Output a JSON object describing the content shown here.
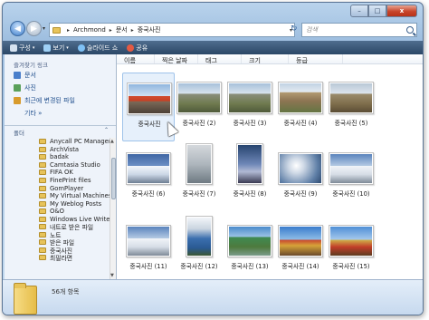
{
  "caption": {
    "minimize": "–",
    "maximize": "□",
    "close": "x"
  },
  "nav": {
    "back": "◀",
    "forward": "▶",
    "dropdown": "▾"
  },
  "address": {
    "crumbs": [
      "Archmond",
      "문서",
      "중국사진"
    ],
    "separator": "▸",
    "dropdown": "▾",
    "refresh": "↻"
  },
  "search": {
    "placeholder": "검색"
  },
  "commandbar": {
    "items": [
      {
        "label": "구성",
        "icon": "organize-icon",
        "dropdown": "▾"
      },
      {
        "label": "보기",
        "icon": "views-icon",
        "dropdown": "▾"
      },
      {
        "label": "슬라이드 쇼",
        "icon": "slideshow-icon",
        "dropdown": ""
      },
      {
        "label": "공유",
        "icon": "share-icon",
        "dropdown": ""
      }
    ]
  },
  "leftpane": {
    "favorites_header": "즐겨찾기 링크",
    "favorites": [
      {
        "label": "문서",
        "icon": "documents-icon",
        "color": "#4a7fcb"
      },
      {
        "label": "사진",
        "icon": "pictures-icon",
        "color": "#5aa05a"
      },
      {
        "label": "최근에 변경된 파일",
        "icon": "recent-icon",
        "color": "#d89b2c"
      }
    ],
    "more": "기타 »",
    "folders_header": "폴더",
    "folders_chevron": "⌃",
    "tree": [
      "Anycall PC Manager",
      "ArchVista",
      "badak",
      "Camtasia Studio",
      "FIFA OK",
      "FinePrint files",
      "GomPlayer",
      "My Virtual Machines",
      "My Weblog Posts",
      "O&O",
      "Windows Live Writer",
      "내트로 받은 파일",
      "노트",
      "받은 파일",
      "중국사진",
      "최필라면"
    ]
  },
  "columns": [
    "이름",
    "찍은 날짜",
    "태그",
    "크기",
    "등급"
  ],
  "photos": [
    {
      "label": "중국사진",
      "style": "p-city",
      "portrait": false,
      "selected": true
    },
    {
      "label": "중국사진 (2)",
      "style": "p-mtn",
      "portrait": false,
      "selected": false
    },
    {
      "label": "중국사진 (3)",
      "style": "p-mtn",
      "portrait": false,
      "selected": false
    },
    {
      "label": "중국사진 (4)",
      "style": "p-wall",
      "portrait": false,
      "selected": false
    },
    {
      "label": "중국사진 (5)",
      "style": "p-mtn2",
      "portrait": false,
      "selected": false
    },
    {
      "label": "중국사진 (6)",
      "style": "p-snow",
      "portrait": false,
      "selected": false
    },
    {
      "label": "중국사진 (7)",
      "style": "p-fog",
      "portrait": true,
      "selected": false
    },
    {
      "label": "중국사진 (8)",
      "style": "p-sunset",
      "portrait": true,
      "selected": false
    },
    {
      "label": "중국사진 (9)",
      "style": "p-sky",
      "portrait": false,
      "selected": false
    },
    {
      "label": "중국사진 (10)",
      "style": "p-peak",
      "portrait": false,
      "selected": false
    },
    {
      "label": "중국사진 (11)",
      "style": "p-peak",
      "portrait": false,
      "selected": false
    },
    {
      "label": "중국사진 (12)",
      "style": "p-tower",
      "portrait": true,
      "selected": false
    },
    {
      "label": "중국사진 (13)",
      "style": "p-river",
      "portrait": false,
      "selected": false
    },
    {
      "label": "중국사진 (14)",
      "style": "p-temple",
      "portrait": false,
      "selected": false
    },
    {
      "label": "중국사진 (15)",
      "style": "p-temple2",
      "portrait": false,
      "selected": false
    }
  ],
  "details": {
    "count": "56개 항목"
  }
}
